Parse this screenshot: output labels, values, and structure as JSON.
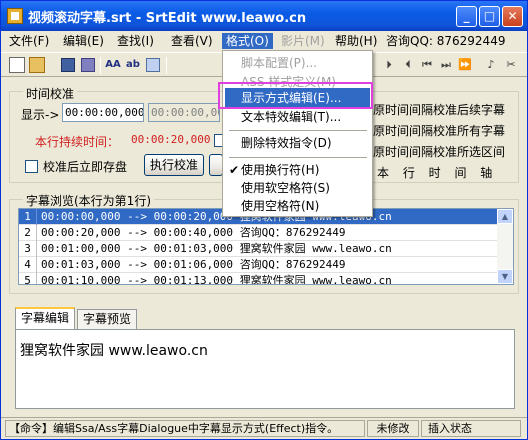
{
  "window": {
    "title": "视频滚动字幕.srt - SrtEdit  www.leawo.cn",
    "minimize": "_",
    "maximize": "□",
    "close": "✕"
  },
  "menubar": {
    "items": [
      "文件(F)",
      "编辑(E)",
      "查找(I)",
      "查看(V)",
      "格式(O)",
      "影片(M)",
      "帮助(H)",
      "咨询QQ: 876292449"
    ]
  },
  "format_menu": {
    "items": [
      "脚本配置(P)...",
      "ASS 样式定义(M)",
      "显示方式编辑(E)...",
      "文本特效编辑(T)...",
      "删除特效指令(D)",
      "使用换行符(H)",
      "使用软空格符(S)",
      "使用空格符(N)"
    ],
    "checked_item": "使用换行符(H)"
  },
  "toolbar": {
    "right_icons": [
      "⏵",
      "⏴",
      "⏮",
      "⏭",
      "⏩",
      "♪",
      "✂"
    ]
  },
  "timing": {
    "group_title": "时间校准",
    "display_label": "显示->",
    "display_value": "00:00:00,000",
    "second_value": "00:00:00,000",
    "duration_label": "本行持续时间：",
    "duration_value": "00:00:20,000",
    "checkbox_label": "校准后立即存盘",
    "calibrate_button": "执行校准",
    "right_options": [
      "原时间间隔校准后续字幕",
      "原时间间隔校准所有字幕",
      "原时间间隔校准所选区间"
    ],
    "axis_text": "本 行 时 间 轴"
  },
  "browser": {
    "title": "字幕浏览(本行为第1行)",
    "rows": [
      {
        "num": "1",
        "time": "00:00:00,000 --> 00:00:20,000",
        "text": "狸窝软件家园 www.leawo.cn"
      },
      {
        "num": "2",
        "time": "00:00:20,000 --> 00:00:40,000",
        "text": "咨询QQ：876292449"
      },
      {
        "num": "3",
        "time": "00:01:00,000 --> 00:01:03,000",
        "text": "狸窝软件家园 www.leawo.cn"
      },
      {
        "num": "4",
        "time": "00:01:03,000 --> 00:01:06,000",
        "text": "咨询QQ：876292449"
      },
      {
        "num": "5",
        "time": "00:01:10,000 --> 00:01:13,000",
        "text": "狸窝软件家园 www.leawo.cn"
      }
    ]
  },
  "tabs": [
    "字幕编辑",
    "字幕预览"
  ],
  "editor": {
    "text": "狸窝软件家园 www.leawo.cn"
  },
  "status": {
    "message": "【命令】编辑Ssa/Ass字幕Dialogue中字幕显示方式(Effect)指令。",
    "modified": "未修改",
    "mode": "插入状态"
  },
  "colors": {
    "titlebar": "#0A5BE6",
    "selection": "#316AC5",
    "highlight_box": "#E040E0",
    "duration_text": "#D02020"
  }
}
